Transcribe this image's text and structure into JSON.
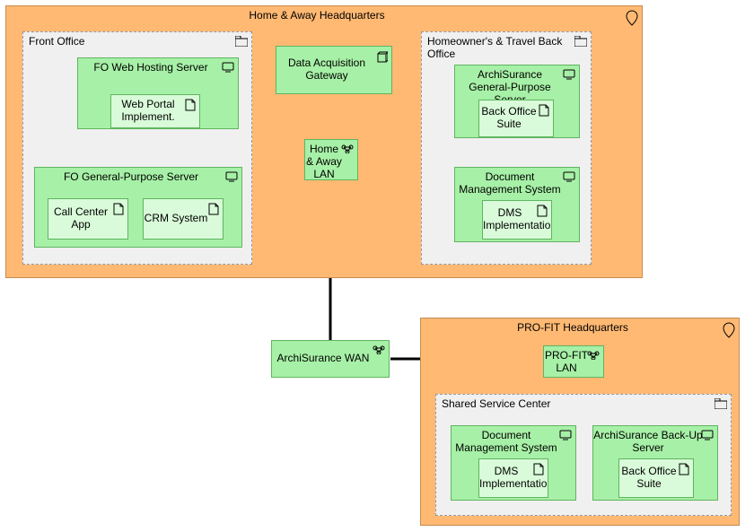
{
  "locations": {
    "haHQ": {
      "title": "Home & Away Headquarters"
    },
    "proHQ": {
      "title": "PRO-FIT Headquarters"
    }
  },
  "groups": {
    "frontOffice": {
      "title": "Front Office"
    },
    "backOffice": {
      "title": "Homeowner's & Travel Back Office"
    },
    "sharedSC": {
      "title": "Shared Service Center"
    }
  },
  "nodes": {
    "dataAcq": {
      "title": "Data Acquisition Gateway",
      "icon": "node3d"
    },
    "haLAN": {
      "title": "Home & Away LAN",
      "icon": "network"
    },
    "archWAN": {
      "title": "ArchiSurance WAN",
      "icon": "network"
    },
    "proLAN": {
      "title": "PRO-FIT LAN",
      "icon": "network"
    },
    "foWeb": {
      "title": "FO Web Hosting Server",
      "icon": "device"
    },
    "foGP": {
      "title": "FO General-Purpose Server",
      "icon": "device"
    },
    "archGP": {
      "title": "ArchiSurance General-Purpose Server",
      "icon": "device"
    },
    "docMgmt1": {
      "title": "Document Management System",
      "icon": "device"
    },
    "docMgmt2": {
      "title": "Document Management System",
      "icon": "device"
    },
    "archBackup": {
      "title": "ArchiSurance Back-Up Server",
      "icon": "device"
    }
  },
  "artifacts": {
    "webPortal": {
      "title": "Web Portal Implement."
    },
    "callCenter": {
      "title": "Call Center App"
    },
    "crm": {
      "title": "CRM System"
    },
    "boSuite1": {
      "title": "Back Office Suite"
    },
    "dms1": {
      "title": "DMS Implementation"
    },
    "dms2": {
      "title": "DMS Implementation"
    },
    "boSuite2": {
      "title": "Back Office Suite"
    }
  }
}
